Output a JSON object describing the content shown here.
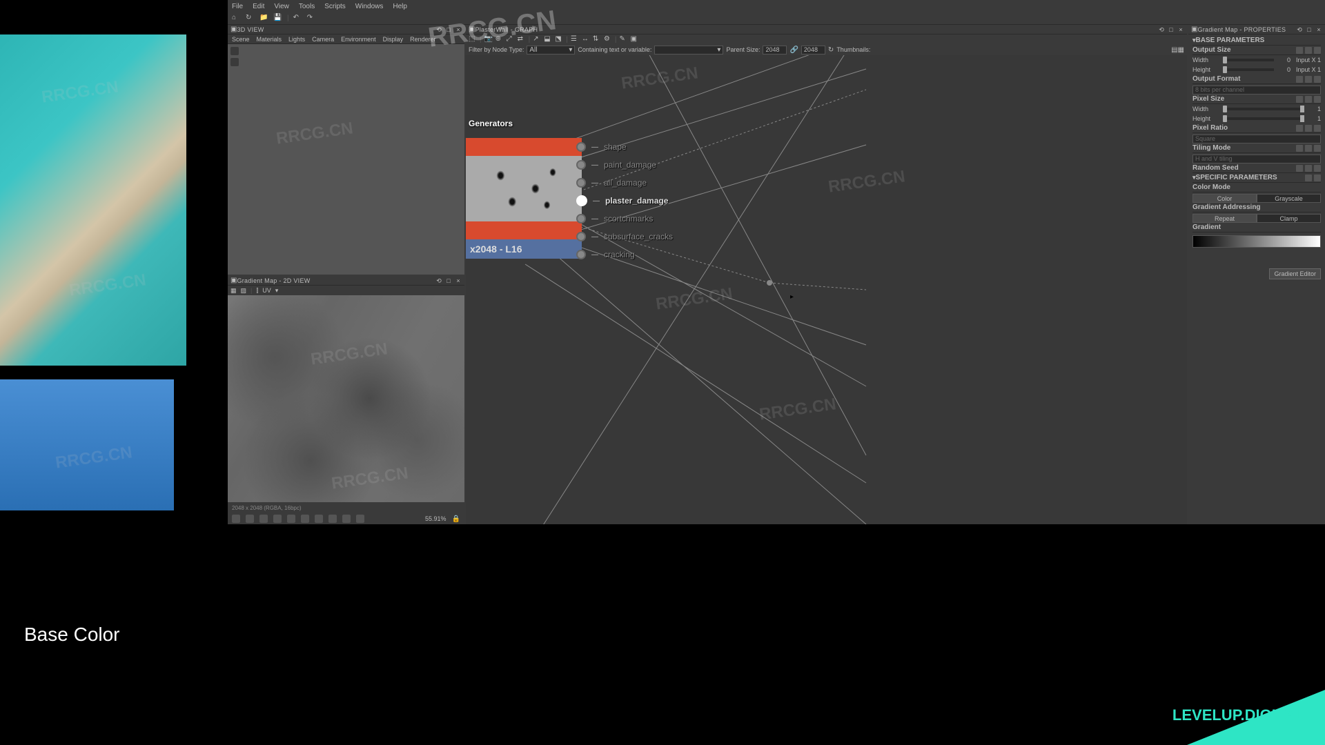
{
  "menu": {
    "file": "File",
    "edit": "Edit",
    "view": "View",
    "tools": "Tools",
    "scripts": "Scripts",
    "windows": "Windows",
    "help": "Help"
  },
  "panels": {
    "view3d": {
      "title": "3D VIEW",
      "tabs": {
        "scene": "Scene",
        "materials": "Materials",
        "lights": "Lights",
        "camera": "Camera",
        "environment": "Environment",
        "display": "Display",
        "renderer": "Renderer"
      }
    },
    "view2d": {
      "title": "Gradient Map - 2D VIEW",
      "uv": "UV",
      "info": "2048 x 2048 (RGBA, 16bpc)",
      "zoom": "55.91%"
    },
    "graph": {
      "title": "PlasterWall - GRAPH",
      "filter_label": "Filter by Node Type:",
      "filter_value": "All",
      "containing_label": "Containing text or variable:",
      "parent_label": "Parent Size:",
      "parent_w": "2048",
      "parent_h": "2048",
      "thumbs": "Thumbnails:"
    },
    "props": {
      "title": "Gradient Map - PROPERTIES"
    }
  },
  "node": {
    "group_title": "Generators",
    "res": "x2048 - L16",
    "outputs": [
      "shape",
      "paint_damage",
      "all_damage",
      "plaster_damage",
      "scortchmarks",
      "subsurface_cracks",
      "cracking"
    ],
    "selected": 3
  },
  "props": {
    "base": "BASE PARAMETERS",
    "specific": "SPECIFIC PARAMETERS",
    "output_size": "Output Size",
    "width": "Width",
    "height": "Height",
    "width_v": "0",
    "height_v": "0",
    "width_u": "Input X 1",
    "height_u": "Input X 1",
    "output_format": "Output Format",
    "format_sel": "8 bits per channel",
    "pixel_size": "Pixel Size",
    "ps_w": "1",
    "ps_h": "1",
    "pixel_ratio": "Pixel Ratio",
    "pratio_sel": "Square",
    "tiling": "Tiling Mode",
    "tiling_sel": "H and V tiling",
    "seed": "Random Seed",
    "color_mode": "Color Mode",
    "cm_color": "Color",
    "cm_gray": "Grayscale",
    "grad_addr": "Gradient Addressing",
    "ga_repeat": "Repeat",
    "ga_clamp": "Clamp",
    "grad": "Gradient",
    "grad_editor": "Gradient Editor"
  },
  "footer": {
    "base_color": "Base Color",
    "brand": "LEVELUP.DIGITAL"
  },
  "watermark_url": "RRCG.CN"
}
